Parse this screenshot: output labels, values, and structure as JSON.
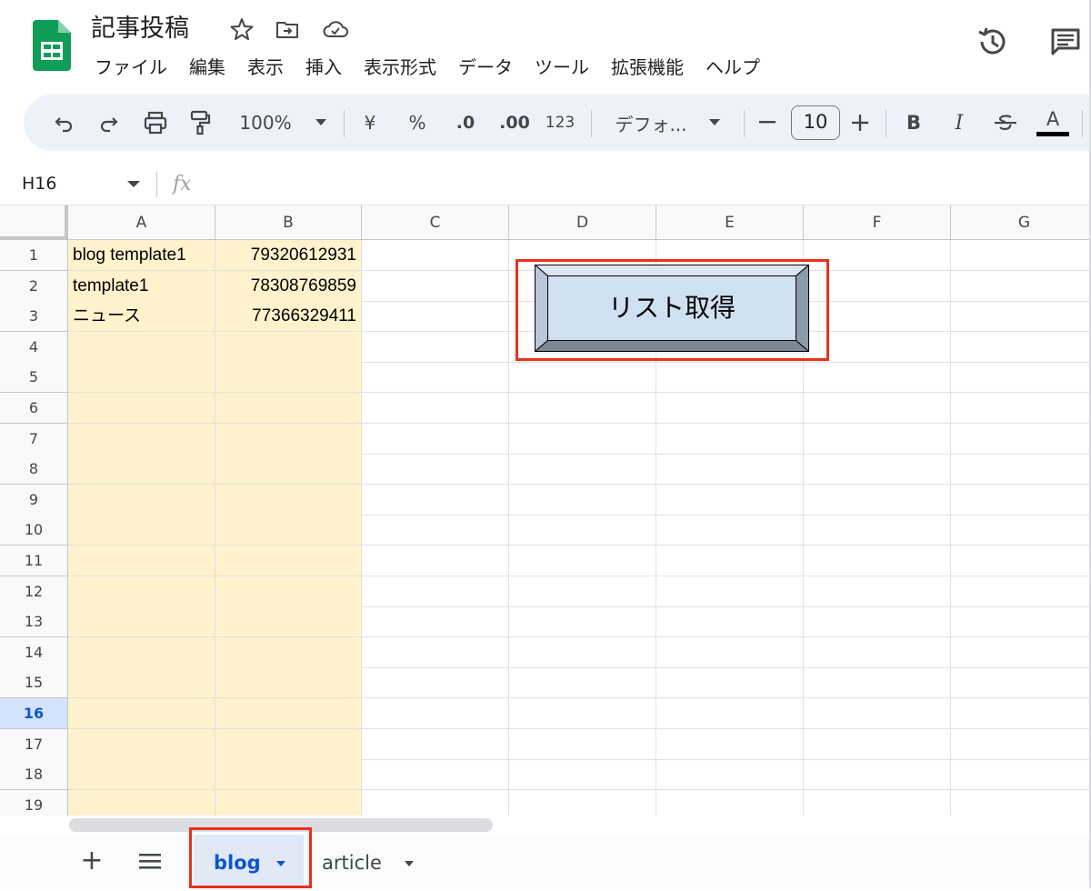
{
  "doc_title": "記事投稿",
  "menu": [
    "ファイル",
    "編集",
    "表示",
    "挿入",
    "表示形式",
    "データ",
    "ツール",
    "拡張機能",
    "ヘルプ"
  ],
  "toolbar": {
    "zoom": "100%",
    "currency": "¥",
    "percent": "%",
    "decrease_decimal": ".0",
    "increase_decimal": ".00",
    "number_format": "123",
    "font": "デフォ...",
    "font_size": "10",
    "bold": "B",
    "italic": "I",
    "text_color": "A",
    "text_color_value": "#000000"
  },
  "formula_bar": {
    "name_box": "H16",
    "fx": "fx"
  },
  "grid": {
    "columns": [
      "A",
      "B",
      "C",
      "D",
      "E",
      "F",
      "G"
    ],
    "rows": [
      "1",
      "2",
      "3",
      "4",
      "5",
      "6",
      "7",
      "8",
      "9",
      "10",
      "11",
      "12",
      "13",
      "14",
      "15",
      "16",
      "17",
      "18",
      "19"
    ],
    "selected_row": "16",
    "cells": {
      "A1": "blog template1",
      "B1": "79320612931",
      "A2": "template1",
      "B2": "78308769859",
      "A3": "ニュース",
      "B3": "77366329411"
    },
    "highlight_fill": "#fff2cc"
  },
  "drawing_button": {
    "label": "リスト取得",
    "fill": "#cfe0f1"
  },
  "sheet_tabs": {
    "add": "+",
    "tabs": [
      {
        "label": "blog",
        "active": true
      },
      {
        "label": "article",
        "active": false
      }
    ]
  },
  "colors": {
    "brand_green": "#0f9d58",
    "accent_blue": "#0b57d0",
    "highlight_red": "#e8311b",
    "toolbar_bg": "#edf2fa"
  }
}
